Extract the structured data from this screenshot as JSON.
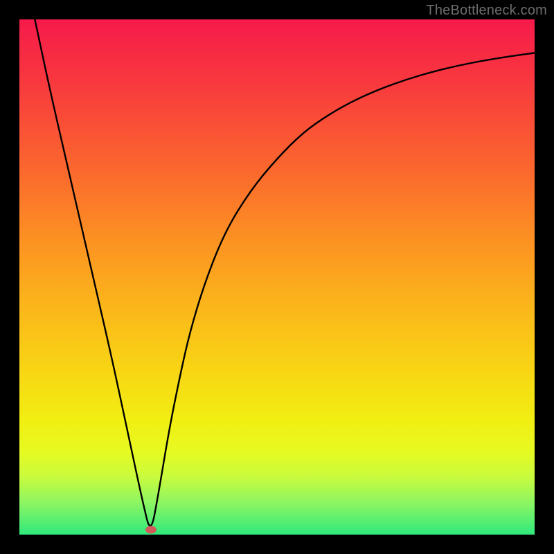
{
  "watermark": "TheBottleneck.com",
  "marker": {
    "x_pct": 25.5,
    "y_pct": 99.0
  },
  "chart_data": {
    "type": "line",
    "title": "",
    "xlabel": "",
    "ylabel": "",
    "xlim": [
      0,
      100
    ],
    "ylim": [
      0,
      100
    ],
    "series": [
      {
        "name": "bottleneck-curve",
        "x": [
          3,
          6,
          9,
          12,
          15,
          18,
          21,
          24,
          25.5,
          27,
          29,
          31,
          33,
          36,
          40,
          45,
          50,
          55,
          60,
          65,
          70,
          75,
          80,
          85,
          90,
          95,
          100
        ],
        "y": [
          100,
          86,
          73,
          60,
          47,
          34,
          20,
          6,
          0,
          8,
          20,
          30,
          39,
          49,
          59,
          67,
          73,
          78,
          81.5,
          84.3,
          86.5,
          88.3,
          89.8,
          91,
          92,
          92.8,
          93.5
        ]
      }
    ],
    "background_gradient_stops": [
      {
        "pos": 0.0,
        "color": "#f61a4a"
      },
      {
        "pos": 0.12,
        "color": "#f8383e"
      },
      {
        "pos": 0.3,
        "color": "#fb6a2d"
      },
      {
        "pos": 0.42,
        "color": "#fc8f23"
      },
      {
        "pos": 0.55,
        "color": "#fbb41b"
      },
      {
        "pos": 0.68,
        "color": "#f8d514"
      },
      {
        "pos": 0.78,
        "color": "#f1ef12"
      },
      {
        "pos": 0.84,
        "color": "#e6fa22"
      },
      {
        "pos": 0.89,
        "color": "#c7fb3f"
      },
      {
        "pos": 0.94,
        "color": "#8af563"
      },
      {
        "pos": 1.0,
        "color": "#2fe97d"
      }
    ],
    "marker": {
      "x": 25.5,
      "y": 0,
      "color": "#d35a5a"
    }
  }
}
